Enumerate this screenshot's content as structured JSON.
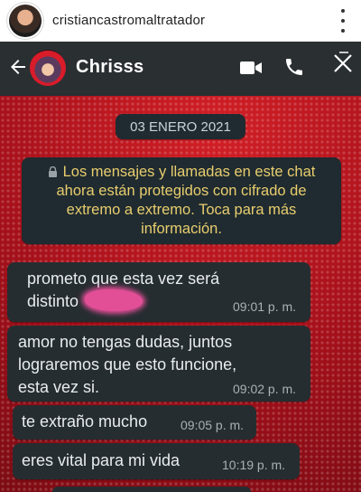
{
  "instagram": {
    "username": "cristiancastromaltratador"
  },
  "chat": {
    "contact_name": "Chrisss",
    "date_chip": "03 ENERO 2021",
    "encryption_notice": "Los mensajes y llamadas en este chat ahora están protegidos con cifrado de extremo a extremo. Toca para más información.",
    "messages": [
      {
        "line1": "prometo que esta vez será",
        "line2": "distinto",
        "time": "09:01 p. m."
      },
      {
        "line1": "amor no tengas dudas, juntos",
        "line2": "lograremos que esto funcione,",
        "line3": "esta vez si.",
        "time": "09:02 p. m."
      },
      {
        "line1": "te extraño mucho",
        "time": "09:05 p. m."
      },
      {
        "line1": "eres vital para mi vida",
        "time": "10:19 p. m."
      }
    ]
  },
  "colors": {
    "header_bar": "#2a2f32",
    "bubble": "#262d31",
    "wallpaper": "#b4121a",
    "encryption_text": "#e9cd6e",
    "redaction": "#e24f97"
  }
}
